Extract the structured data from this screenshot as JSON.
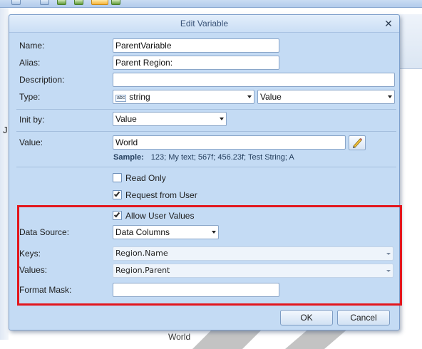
{
  "dialog": {
    "title": "Edit Variable",
    "close_glyph": "✕"
  },
  "fields": {
    "name": {
      "label": "Name:",
      "value": "ParentVariable"
    },
    "alias": {
      "label": "Alias:",
      "value": "Parent Region:"
    },
    "description": {
      "label": "Description:",
      "value": ""
    },
    "type": {
      "label": "Type:",
      "type_icon_text": "abc",
      "type_value": "string",
      "kind_value": "Value"
    },
    "init_by": {
      "label": "Init by:",
      "value": "Value"
    },
    "value": {
      "label": "Value:",
      "value": "World"
    },
    "sample": {
      "label": "Sample:",
      "text": "123; My text; 567f; 456.23f; Test String; A"
    }
  },
  "checkboxes": {
    "read_only": {
      "label": "Read Only",
      "checked": false
    },
    "request_from_user": {
      "label": "Request from User",
      "checked": true
    },
    "allow_user_values": {
      "label": "Allow User Values",
      "checked": true
    }
  },
  "user_values": {
    "data_source": {
      "label": "Data Source:",
      "value": "Data Columns"
    },
    "keys": {
      "label": "Keys:",
      "value": "Region.Name"
    },
    "values": {
      "label": "Values:",
      "value": "Region.Parent"
    },
    "format_mask": {
      "label": "Format Mask:",
      "value": ""
    }
  },
  "buttons": {
    "ok": "OK",
    "cancel": "Cancel"
  },
  "background": {
    "left_letter": "J",
    "bottom_text": "World"
  },
  "colors": {
    "dialog_bg": "#c4dbf4",
    "highlight_frame": "#e3161d",
    "title_text": "#3a5378"
  },
  "icons": {
    "close": "close-icon",
    "edit": "pencil-icon",
    "dropdown": "chevron-down-icon",
    "type": "string-type-icon"
  }
}
